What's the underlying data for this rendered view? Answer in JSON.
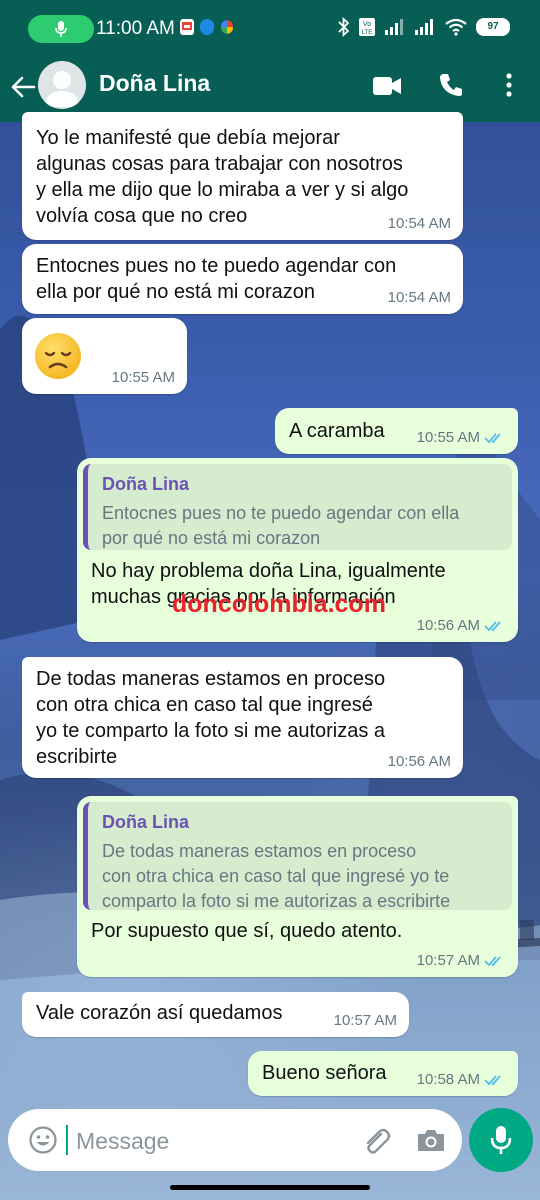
{
  "status_bar": {
    "time": "11:00 AM",
    "battery": "97",
    "icons": [
      "mic-icon",
      "gmail-icon",
      "messenger-icon",
      "photos-icon",
      "bluetooth-icon",
      "volte-icon",
      "signal-icon",
      "wifi-icon",
      "battery-icon"
    ]
  },
  "header": {
    "contact_name": "Doña Lina",
    "icons": [
      "back-arrow-icon",
      "avatar-icon",
      "video-call-icon",
      "voice-call-icon",
      "more-vert-icon"
    ]
  },
  "messages": [
    {
      "direction": "in",
      "text": [
        "Yo le manifesté que debía mejorar",
        "algunas cosas para trabajar con nosotros",
        "y ella me dijo que lo miraba a ver y si algo",
        "volvía cosa que no creo"
      ],
      "time": "10:54 AM"
    },
    {
      "direction": "in",
      "text": [
        "Entocnes pues no te puedo agendar con",
        "ella por qué no está mi corazon"
      ],
      "time": "10:54 AM"
    },
    {
      "direction": "in",
      "text": [
        "😞"
      ],
      "time": "10:55 AM"
    },
    {
      "direction": "out",
      "text": [
        "A caramba"
      ],
      "time": "10:55 AM",
      "read": true
    },
    {
      "direction": "out",
      "quote": {
        "name": "Doña Lina",
        "text": [
          "Entocnes pues no te puedo agendar con ella",
          "por qué no está mi corazon"
        ]
      },
      "text": [
        "No hay problema doña Lina, igualmente",
        "muchas gracias por la información"
      ],
      "time": "10:56 AM",
      "read": true
    },
    {
      "direction": "in",
      "text": [
        "De todas maneras estamos en proceso",
        "con otra chica en caso tal que ingresé",
        "yo te comparto la foto si me autorizas a",
        "escribirte"
      ],
      "time": "10:56 AM"
    },
    {
      "direction": "out",
      "quote": {
        "name": "Doña Lina",
        "text": [
          "De todas maneras estamos en proceso",
          "con otra chica en caso tal que ingresé yo te",
          "comparto la foto si me autorizas a escribirte"
        ]
      },
      "text": [
        "Por supuesto que sí, quedo atento."
      ],
      "time": "10:57 AM",
      "read": true
    },
    {
      "direction": "in",
      "text": [
        "Vale corazón así quedamos"
      ],
      "time": "10:57 AM"
    },
    {
      "direction": "out",
      "text": [
        "Bueno señora"
      ],
      "time": "10:58 AM",
      "read": true
    }
  ],
  "watermark": {
    "part1": "don",
    "part2": "colombia",
    "part3": ".com"
  },
  "input_bar": {
    "placeholder": "Message",
    "icons": [
      "emoji-icon",
      "attach-icon",
      "camera-icon",
      "mic-icon"
    ]
  },
  "colors": {
    "header": "#075e54",
    "outgoing_bubble": "#e7ffdb",
    "incoming_bubble": "#ffffff",
    "accent": "#00a884",
    "quote_name": "#6b52b5",
    "read_ticks": "#53bdeb"
  }
}
